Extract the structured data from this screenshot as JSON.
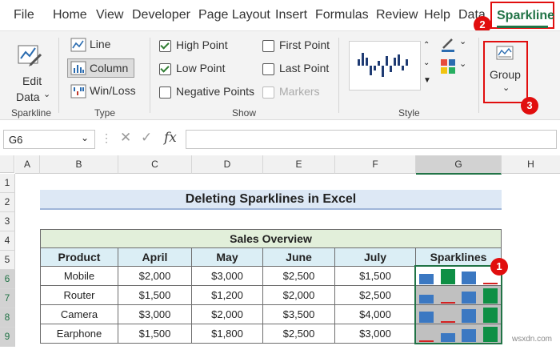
{
  "colors": {
    "accent": "#217346",
    "highlight_red": "#e10e0e",
    "title_fill": "#dde8f5",
    "header_fill": "#dbeef5",
    "overview_fill": "#e2efda",
    "sparkline_fill": "#c0c0c0"
  },
  "tabs": [
    "File",
    "Home",
    "View",
    "Developer",
    "Page Layout",
    "Insert",
    "Formulas",
    "Review",
    "Help",
    "Data",
    "Sparkline"
  ],
  "ribbon": {
    "edit_data": {
      "line1": "Edit",
      "line2": "Data"
    },
    "group_sparkline": "Sparkline",
    "type": {
      "line": "Line",
      "column": "Column",
      "winloss": "Win/Loss",
      "group_label": "Type"
    },
    "show": {
      "high_point": "High Point",
      "low_point": "Low Point",
      "negative_points": "Negative Points",
      "first_point": "First Point",
      "last_point": "Last Point",
      "markers": "Markers",
      "group_label": "Show"
    },
    "style": {
      "group_label": "Style"
    },
    "group_btn": "Group"
  },
  "formula_bar": {
    "name_box": "G6",
    "fx": "fx",
    "value": ""
  },
  "sheet": {
    "columns": [
      "A",
      "B",
      "C",
      "D",
      "E",
      "F",
      "G",
      "H"
    ],
    "rows": [
      "1",
      "2",
      "3",
      "4",
      "5",
      "6",
      "7",
      "8",
      "9"
    ],
    "title": "Deleting Sparklines in Excel",
    "overview": "Sales Overview",
    "headers": [
      "Product",
      "April",
      "May",
      "June",
      "July",
      "Sparklines"
    ],
    "data": [
      [
        "Mobile",
        "$2,000",
        "$3,000",
        "$2,500",
        "$1,500"
      ],
      [
        "Router",
        "$1,500",
        "$1,200",
        "$2,000",
        "$2,500"
      ],
      [
        "Camera",
        "$3,000",
        "$2,000",
        "$3,500",
        "$4,000"
      ],
      [
        "Earphone",
        "$1,500",
        "$1,800",
        "$2,500",
        "$3,000"
      ]
    ],
    "sparkline_values": [
      [
        2000,
        3000,
        2500,
        1500
      ],
      [
        1500,
        1200,
        2000,
        2500
      ],
      [
        3000,
        2000,
        3500,
        4000
      ],
      [
        1500,
        1800,
        2500,
        3000
      ]
    ]
  },
  "badges": [
    "1",
    "2",
    "3"
  ]
}
